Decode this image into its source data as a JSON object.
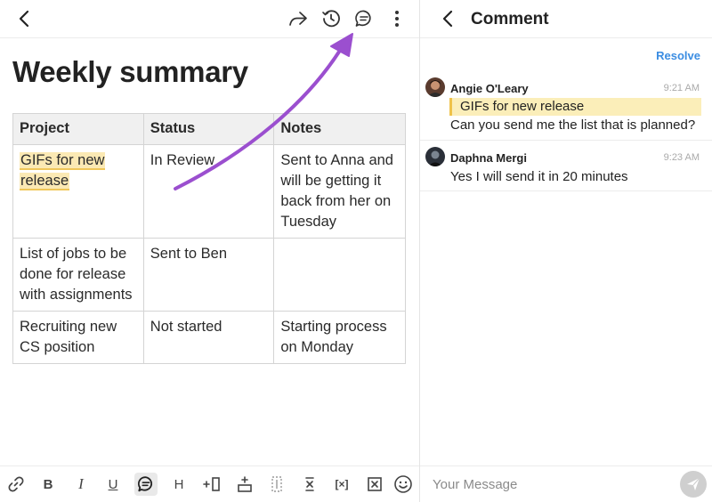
{
  "document": {
    "title": "Weekly summary",
    "table": {
      "headers": [
        "Project",
        "Status",
        "Notes"
      ],
      "rows": [
        [
          "GIFs for new release",
          "In Review",
          "Sent to Anna and will be getting it back from her on Tuesday"
        ],
        [
          "List of jobs to be done for release with assignments",
          "Sent to Ben",
          ""
        ],
        [
          "Recruiting new CS position",
          "Not started",
          "Starting process on Monday"
        ]
      ]
    }
  },
  "topbar": {
    "icons": [
      "back-icon",
      "share-icon",
      "history-icon",
      "comment-icon",
      "more-icon"
    ]
  },
  "toolbar": {
    "bold_label": "B",
    "italic_label": "I",
    "underline_label": "U",
    "heading_label": "H",
    "variable_label": "[×]"
  },
  "comments_panel": {
    "title": "Comment",
    "resolve_label": "Resolve",
    "comments": [
      {
        "author": "Angie O'Leary",
        "time": "9:21 AM",
        "quote": "GIFs for new release",
        "text": "Can you send me the list that is planned?"
      },
      {
        "author": "Daphna Mergi",
        "time": "9:23 AM",
        "text": "Yes I will send it in 20 minutes"
      }
    ],
    "message_placeholder": "Your Message"
  },
  "colors": {
    "accent": "#3b8de2",
    "highlight": "#fbe9b4",
    "annotation_arrow": "#9b4fcf"
  }
}
